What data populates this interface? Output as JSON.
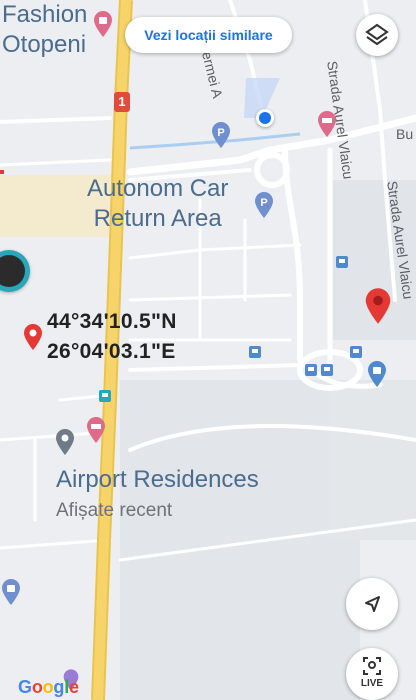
{
  "map": {
    "places": {
      "fashion_line1": "Fashion",
      "fashion_line2": "Otopeni",
      "autonom_line1": "Autonom Car",
      "autonom_line2": "Return Area",
      "airport_residences": "Airport Residences",
      "airport_residences_sub": "Afișate recent"
    },
    "coordinates": {
      "lat": "44°34'10.5\"N",
      "lon": "26°04'03.1\"E"
    },
    "streets": {
      "aurel_vlaicu_top": "Strada Aurel Vlaicu",
      "aurel_vlaicu_right": "Strada Aurel Vlaicu",
      "hermei": "Hermei A",
      "bu": "Bu"
    },
    "road_shield": "1",
    "similar_locations_button": "Vezi locații similare",
    "google_logo": "Google",
    "live_button": "LIVE"
  },
  "colors": {
    "road_yellow": "#f7d46a",
    "road_white": "#ffffff",
    "water": "#aacdf2",
    "pin_red": "#e53935",
    "blue_dot": "#1a73e8",
    "parking_blue": "#6f8fce",
    "hotel_pink": "#e06a8a",
    "bus_blue": "#4f8ad0",
    "cyan_bus": "#27a7b9",
    "sand_area": "#f4ebcf"
  },
  "icons": [
    "layers-icon",
    "location-pin-icon",
    "current-location-dot",
    "parking-icon",
    "hotel-icon",
    "bus-stop-icon",
    "shopping-icon",
    "navigation-arrow-icon",
    "live-view-icon"
  ]
}
